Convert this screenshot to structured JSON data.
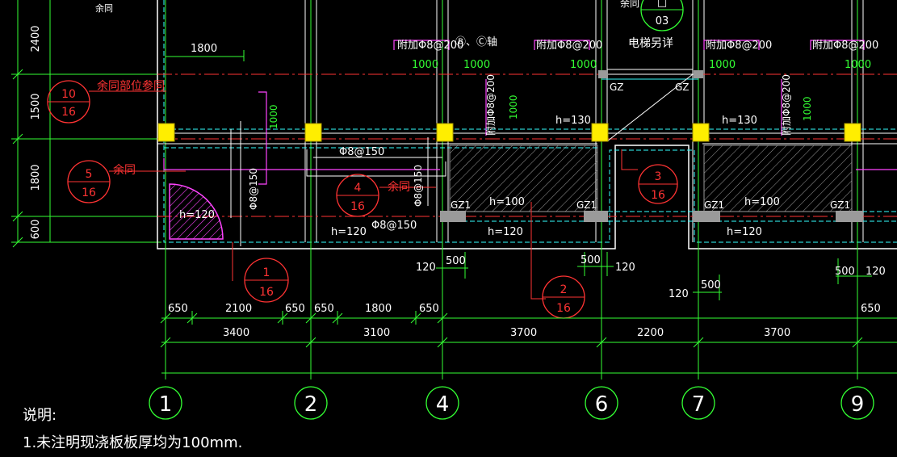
{
  "drawing": {
    "top_dims": {
      "dim_2400": "2400",
      "dim_1500": "1500",
      "dim_1800": "1800",
      "dim_600": "600",
      "dim_1800_top": "1800"
    },
    "labels": {
      "yutong_top": "余同",
      "yutong_bwcj": "余同部位参同",
      "yutong_5": "余同",
      "yutong_4": "余同",
      "yutong_top_right": "余同",
      "elevator": "电梯另详",
      "axis_note": "Ⓑ、Ⓒ轴",
      "add_bar_1": "附加Φ8@200",
      "add_bar_2": "附加Φ8@200",
      "add_bar_3": "附加Φ8@200",
      "add_bar_4": "附加Φ8@200",
      "add_bar_v1": "附加Φ8@200",
      "add_bar_v2": "附加Φ8@200",
      "bar_150_h": "Φ8@150",
      "bar_150_v1": "Φ8@150",
      "bar_150_v2": "Φ8@150",
      "bar_150_b": "Φ8@150",
      "len_1000_1": "1000",
      "len_1000_2": "1000",
      "len_1000_3": "1000",
      "len_1000_4": "1000",
      "len_1000_5": "1000",
      "len_1000_v1": "1000",
      "len_1000_v2": "1000",
      "len_1000_v3": "1000",
      "h130_a": "h=130",
      "h130_b": "h=130",
      "h120_a": "h=120",
      "h120_b": "h=120",
      "h120_c": "h=120",
      "h120_d": "h=120",
      "h100_a": "h=100",
      "h100_b": "h=100",
      "gz_a": "GZ",
      "gz_b": "GZ",
      "gz1_a": "GZ1",
      "gz1_b": "GZ1",
      "gz1_c": "GZ1",
      "gz1_d": "GZ1"
    },
    "callouts": [
      {
        "num": "10",
        "den": "16"
      },
      {
        "num": "5",
        "den": "16"
      },
      {
        "num": "4",
        "den": "16"
      },
      {
        "num": "1",
        "den": "16"
      },
      {
        "num": "2",
        "den": "16"
      },
      {
        "num": "3",
        "den": "16"
      },
      {
        "num": "□",
        "den": "03"
      }
    ],
    "small_dims": {
      "d500_a": "500",
      "d500_b": "500",
      "d500_c": "500",
      "d500_d": "500",
      "d120_a": "120",
      "d120_b": "120",
      "d120_c": "120",
      "d120_d": "120"
    },
    "dim_row1": [
      "650",
      "2100",
      "650",
      "650",
      "1800",
      "650",
      "650"
    ],
    "dim_row2": [
      "3400",
      "3100",
      "3700",
      "2200",
      "3700"
    ],
    "axes": [
      "1",
      "2",
      "4",
      "6",
      "7",
      "9"
    ]
  },
  "notes": {
    "title": "说明:",
    "line1": "1.未注明现浇板板厚均为100mm."
  },
  "colors": {
    "background": "#000000",
    "green": "#33ff33",
    "red": "#ff3333",
    "magenta": "#ff44ff",
    "yellow": "#ffee00",
    "cyan": "#33ffff",
    "white": "#ffffff"
  }
}
